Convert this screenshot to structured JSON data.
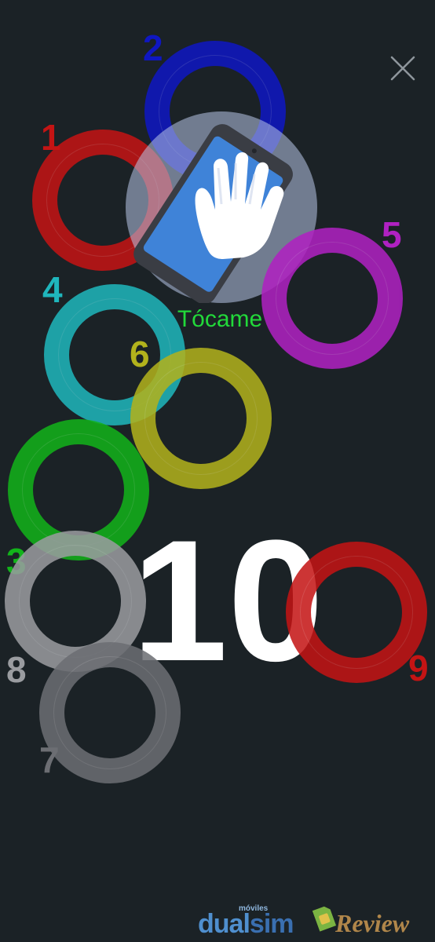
{
  "close_button": {
    "icon": "close-icon",
    "color": "#8e969c"
  },
  "touch_hint": {
    "label": "Tócame",
    "label_color": "#22d93a",
    "icon": "hand-tap-phone-icon"
  },
  "counter": {
    "value": "10"
  },
  "touch_points": [
    {
      "number": "1",
      "color": "#c41414"
    },
    {
      "number": "2",
      "color": "#0f17c2"
    },
    {
      "number": "3",
      "color": "#12b31a"
    },
    {
      "number": "4",
      "color": "#1fb6bc"
    },
    {
      "number": "5",
      "color": "#b021c2"
    },
    {
      "number": "6",
      "color": "#b2b21c"
    },
    {
      "number": "7",
      "color": "#6c6e73"
    },
    {
      "number": "8",
      "color": "#9a9ca0"
    },
    {
      "number": "9",
      "color": "#c41414"
    }
  ],
  "watermark": {
    "small": "móviles",
    "dual": "dual",
    "sim": "sim",
    "review": "Review"
  }
}
